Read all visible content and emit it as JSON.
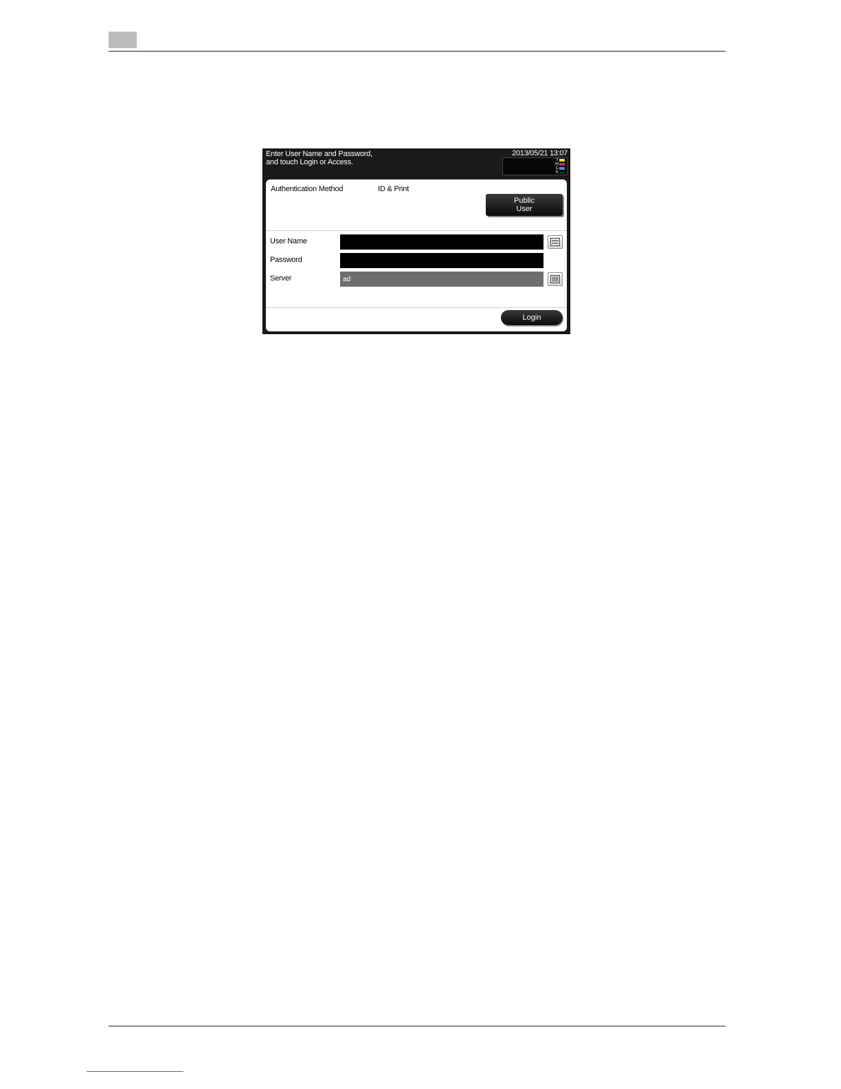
{
  "panel": {
    "message_line1": "Enter User Name and Password,",
    "message_line2": "and touch Login or Access.",
    "datetime": "2013/05/21 13:07",
    "toner": [
      {
        "letter": "Y",
        "color": "#f2e000"
      },
      {
        "letter": "M",
        "color": "#e0177a"
      },
      {
        "letter": "C",
        "color": "#1f9fe0"
      },
      {
        "letter": "K",
        "color": "#222222"
      }
    ],
    "auth_method_label": "Authentication Method",
    "auth_method_value": "ID & Print",
    "public_user_line1": "Public",
    "public_user_line2": "User",
    "fields": {
      "user_name_label": "User Name",
      "user_name_value": "",
      "password_label": "Password",
      "password_value": "",
      "server_label": "Server",
      "server_value": "ad"
    },
    "login_label": "Login"
  },
  "icons": {
    "keyboard": "keyboard-icon"
  }
}
